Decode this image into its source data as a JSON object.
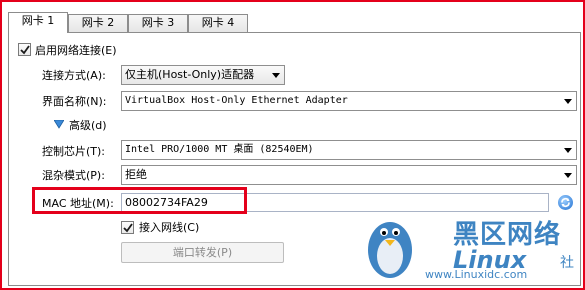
{
  "tabs": [
    {
      "label": "网卡 1",
      "active": true
    },
    {
      "label": "网卡 2",
      "active": false
    },
    {
      "label": "网卡 3",
      "active": false
    },
    {
      "label": "网卡 4",
      "active": false
    }
  ],
  "enable_adapter": {
    "label": "启用网络连接(E)",
    "checked": true
  },
  "attached_to": {
    "label": "连接方式(A):",
    "value": "仅主机(Host-Only)适配器"
  },
  "name": {
    "label": "界面名称(N):",
    "value": "VirtualBox Host-Only Ethernet Adapter"
  },
  "advanced": {
    "label": "高级(d)"
  },
  "adapter_type": {
    "label": "控制芯片(T):",
    "value": "Intel PRO/1000 MT 桌面 (82540EM)"
  },
  "promiscuous": {
    "label": "混杂模式(P):",
    "value": "拒绝"
  },
  "mac": {
    "label": "MAC 地址(M):",
    "value": "08002734FA29"
  },
  "cable_connected": {
    "label": "接入网线(C)",
    "checked": true
  },
  "port_forwarding": {
    "label": "端口转发(P)"
  },
  "watermark": {
    "brand": "黑区网络",
    "site": "www.Linuxidc.com",
    "logo": "Linux",
    "suffix": "社"
  },
  "colors": {
    "highlight_border": "#e4001b",
    "watermark": "#1d6fb8"
  }
}
